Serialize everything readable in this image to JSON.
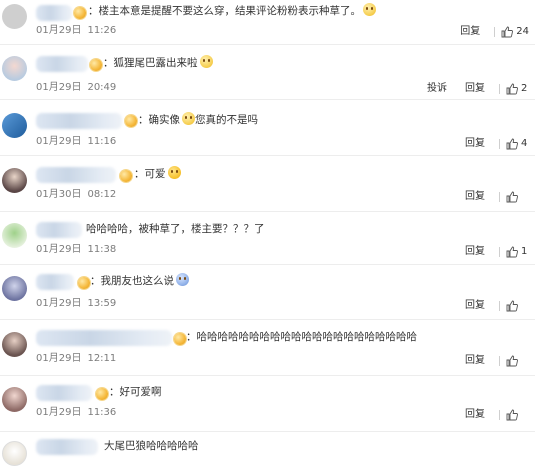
{
  "labels": {
    "reply": "回复",
    "report": "投诉"
  },
  "comments": [
    {
      "text": "：楼主本意是提醒不要这么穿，结果评论粉粉表示种草了。",
      "date": "01月29日",
      "time": "11:26",
      "likes": "24",
      "report": false,
      "avatar_color": "#cfcfcf"
    },
    {
      "text": "：狐狸尾巴露出来啦",
      "date": "01月29日",
      "time": "20:49",
      "likes": "2",
      "report": true,
      "avatar_color": "#b8cbe0"
    },
    {
      "text": "：确实像",
      "text2": "您真的不是吗",
      "date": "01月29日",
      "time": "11:16",
      "likes": "4",
      "report": false,
      "avatar_color": "#2c6fb5"
    },
    {
      "text": "：可爱",
      "date": "01月30日",
      "time": "08:12",
      "likes": "",
      "report": false,
      "avatar_color": "#6b5a5a"
    },
    {
      "text": "哈哈哈哈，被种草了，楼主要？？？了",
      "date": "01月29日",
      "time": "11:38",
      "likes": "1",
      "report": false,
      "avatar_color": "#d9e8d0"
    },
    {
      "text": "：我朋友也这么说",
      "date": "01月29日",
      "time": "13:59",
      "likes": "",
      "report": false,
      "avatar_color": "#8a8fb8"
    },
    {
      "text": "：哈哈哈哈哈哈哈哈哈哈哈哈哈哈哈哈哈哈哈哈哈",
      "date": "01月29日",
      "time": "12:11",
      "likes": "",
      "report": false,
      "avatar_color": "#7a6460"
    },
    {
      "text": "：好可爱啊",
      "date": "01月29日",
      "time": "11:36",
      "likes": "",
      "report": false,
      "avatar_color": "#a17e7a"
    },
    {
      "text": "大尾巴狼哈哈哈哈哈",
      "date": "",
      "time": "",
      "likes": "",
      "report": false,
      "avatar_color": "#e7e2d8"
    }
  ]
}
